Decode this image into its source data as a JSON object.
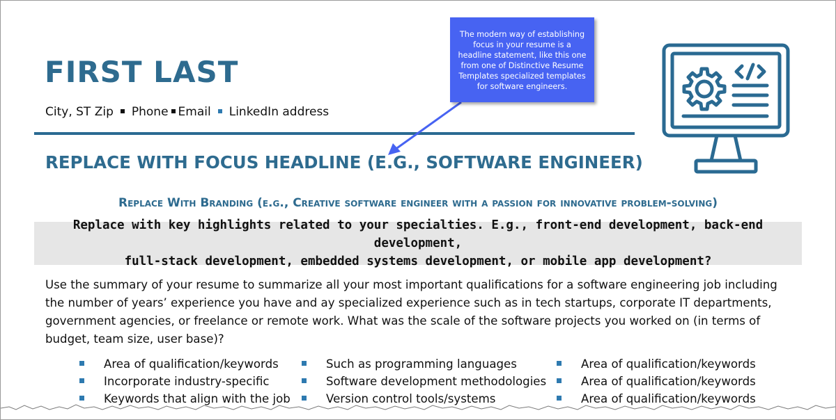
{
  "resume": {
    "name": "FIRST LAST",
    "contact": {
      "location": "City, ST Zip",
      "phone": "Phone",
      "email": "Email",
      "linkedin": "LinkedIn address"
    },
    "focus_headline": "REPLACE WITH FOCUS HEADLINE (E.G., SOFTWARE ENGINEER)",
    "branding": "Replace With Branding (e.g., Creative software engineer with a passion for innovative problem-solving)",
    "highlights": {
      "line1": "Replace with key highlights related to your specialties. E.g., front-end development, back-end development,",
      "line2": "full-stack development, embedded systems development, or mobile app development?"
    },
    "summary": "Use the summary of your resume to summarize all your most important qualifications for a software engineering job including the number of years’ experience you have and ay specialized experience such as in tech startups, corporate IT departments, government agencies, or freelance or remote work. What was the scale of the software projects you worked on (in terms of budget, team size, user base)?",
    "skills": {
      "col1": [
        "Area of qualification/keywords",
        "Incorporate industry-specific",
        "Keywords that align with the job"
      ],
      "col2": [
        "Such as programming languages",
        "Software development methodologies",
        "Version control tools/systems"
      ],
      "col3": [
        "Area of qualification/keywords",
        "Area of qualification/keywords",
        "Area of qualification/keywords"
      ]
    }
  },
  "callout": {
    "text": "The modern way of establishing focus in your resume is a headline statement, like this one from one of Distinctive Resume Templates specialized templates for software engineers."
  },
  "icons": {
    "monitor": "computer-monitor-code-gear-icon"
  },
  "colors": {
    "accent": "#2e6b8f",
    "callout_bg": "#4763f2",
    "highlight_bg": "#e6e6e6"
  }
}
